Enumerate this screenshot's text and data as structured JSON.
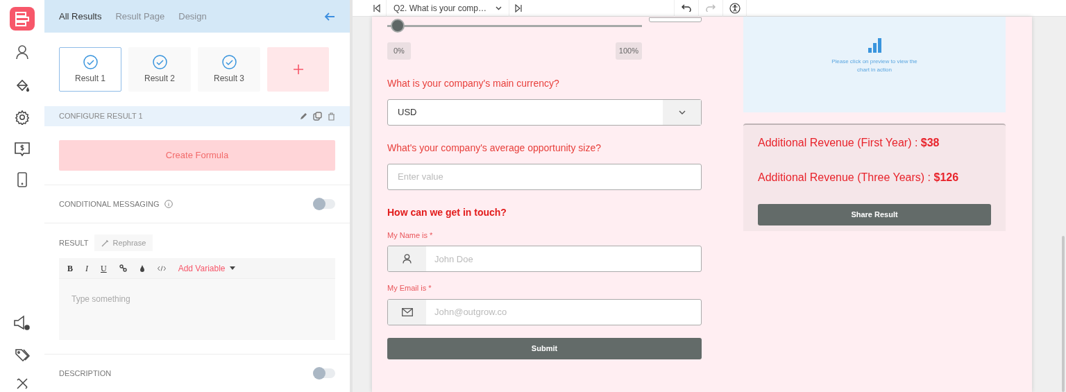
{
  "panel": {
    "tabs": [
      {
        "label": "All Results",
        "selected": true
      },
      {
        "label": "Result Page",
        "selected": false
      },
      {
        "label": "Design",
        "selected": false
      }
    ],
    "results": [
      {
        "label": "Result 1",
        "selected": true
      },
      {
        "label": "Result 2",
        "selected": false
      },
      {
        "label": "Result 3",
        "selected": false
      }
    ],
    "configure_title": "CONFIGURE RESULT 1",
    "create_formula": "Create Formula",
    "conditional_messaging": {
      "label": "CONDITIONAL MESSAGING",
      "on": false
    },
    "result": {
      "label": "RESULT",
      "rephrase": "Rephrase",
      "format_buttons": [
        "B",
        "I",
        "U"
      ],
      "add_variable": "Add Variable",
      "placeholder": "Type something"
    },
    "description": {
      "label": "DESCRIPTION",
      "on": false
    }
  },
  "toolbar": {
    "question": "Q2. What is your comp…"
  },
  "form": {
    "slider": {
      "level": 0.04,
      "min_label": "0%",
      "max_label": "100%"
    },
    "currency": {
      "question": "What is your company's main currency?",
      "value": "USD"
    },
    "opportunity": {
      "question": "What's your company's average opportunity size?",
      "placeholder": "Enter value"
    },
    "contact_title": "How can we get in touch?",
    "fields": [
      {
        "kind": "name",
        "label": "My Name is *",
        "placeholder": "John Doe"
      },
      {
        "kind": "email",
        "label": "My Email is *",
        "placeholder": "John@outgrow.co"
      }
    ],
    "submit": "Submit"
  },
  "results_panel": {
    "chart_hint": "Please click on preview to view the chart in action",
    "lines": [
      {
        "label": "Additional Revenue (First Year) : ",
        "value": "$38"
      },
      {
        "label": "Additional Revenue (Three Years) : ",
        "value": "$126"
      }
    ],
    "share": "Share Result"
  }
}
